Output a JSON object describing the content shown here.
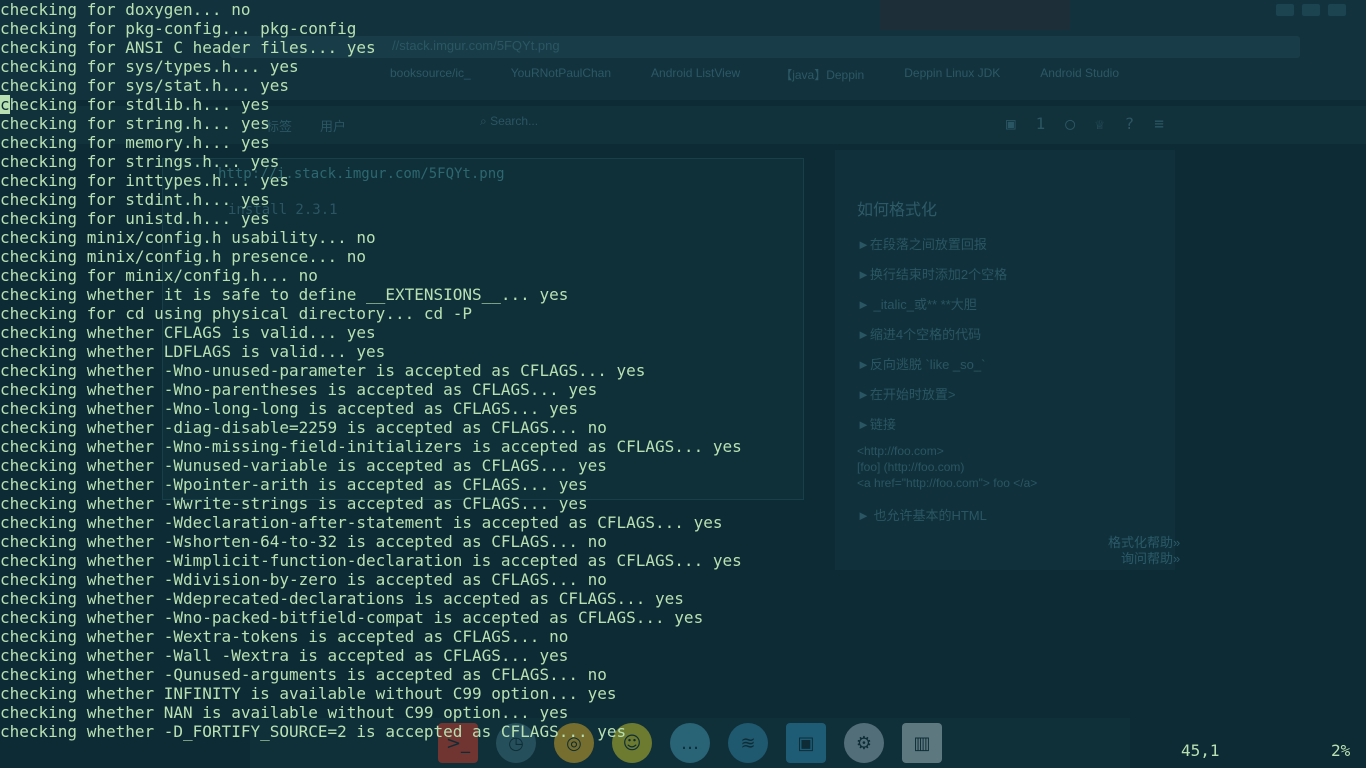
{
  "background": {
    "url_text": "//stack.imgur.com/5FQYt.png",
    "bookmarks": [
      "booksource/ic_",
      "YouRNotPaulChan",
      "Android ListView",
      "【java】Deppin",
      "Deppin Linux JDK",
      "Android Studio"
    ],
    "nav_items": [
      "标签",
      "用户"
    ],
    "search_placeholder": "Search...",
    "notification_count": "1",
    "link_text": "http://i.stack.imgur.com/5FQYt.png",
    "install_text": "install 2.3.1",
    "side_title": "如何格式化",
    "side_list": [
      "►在段落之间放置回报",
      "►换行结束时添加2个空格",
      "► _italic_或** **大胆",
      "►缩进4个空格的代码",
      "►反向逃脱 `like _so_`",
      "►在开始时放置>",
      "►链接"
    ],
    "side_code": [
      "<http://foo.com>",
      "[foo] (http://foo.com)",
      "<a href=\"http://foo.com\"> foo </a>"
    ],
    "side_html": "► 也允许基本的HTML",
    "side_links": [
      "格式化帮助»",
      "询问帮助»"
    ]
  },
  "terminal": {
    "lines": [
      "checking for doxygen... no",
      "checking for pkg-config... pkg-config",
      "checking for ANSI C header files... yes",
      "checking for sys/types.h... yes",
      "checking for sys/stat.h... yes",
      "checking for stdlib.h... yes",
      "checking for string.h... yes",
      "checking for memory.h... yes",
      "checking for strings.h... yes",
      "checking for inttypes.h... yes",
      "checking for stdint.h... yes",
      "checking for unistd.h... yes",
      "checking minix/config.h usability... no",
      "checking minix/config.h presence... no",
      "checking for minix/config.h... no",
      "checking whether it is safe to define __EXTENSIONS__... yes",
      "checking for cd using physical directory... cd -P",
      "checking whether CFLAGS is valid... yes",
      "checking whether LDFLAGS is valid... yes",
      "checking whether -Wno-unused-parameter is accepted as CFLAGS... yes",
      "checking whether -Wno-parentheses is accepted as CFLAGS... yes",
      "checking whether -Wno-long-long is accepted as CFLAGS... yes",
      "checking whether -diag-disable=2259 is accepted as CFLAGS... no",
      "checking whether -Wno-missing-field-initializers is accepted as CFLAGS... yes",
      "checking whether -Wunused-variable is accepted as CFLAGS... yes",
      "checking whether -Wpointer-arith is accepted as CFLAGS... yes",
      "checking whether -Wwrite-strings is accepted as CFLAGS... yes",
      "checking whether -Wdeclaration-after-statement is accepted as CFLAGS... yes",
      "checking whether -Wshorten-64-to-32 is accepted as CFLAGS... no",
      "checking whether -Wimplicit-function-declaration is accepted as CFLAGS... yes",
      "checking whether -Wdivision-by-zero is accepted as CFLAGS... no",
      "checking whether -Wdeprecated-declarations is accepted as CFLAGS... yes",
      "checking whether -Wno-packed-bitfield-compat is accepted as CFLAGS... yes",
      "checking whether -Wextra-tokens is accepted as CFLAGS... no",
      "checking whether -Wall -Wextra is accepted as CFLAGS... yes",
      "checking whether -Qunused-arguments is accepted as CFLAGS... no",
      "checking whether INFINITY is available without C99 option... yes",
      "checking whether NAN is available without C99 option... yes",
      "checking whether -D_FORTIFY_SOURCE=2 is accepted as CFLAGS... yes"
    ],
    "cursor_line_index": 5,
    "cursor_char": "c",
    "cursor_rest": "hecking for stdlib.h... yes"
  },
  "status": {
    "position": "45,1",
    "percent": "2%"
  },
  "colors": {
    "background": "#0d2b35",
    "text": "#b8e0b2"
  },
  "dock": {
    "icons": [
      "terminal-icon",
      "clock-icon",
      "chrome-icon",
      "emoji-icon",
      "chat-icon",
      "wifi-icon",
      "screenshot-icon",
      "steam-icon",
      "trash-icon"
    ]
  }
}
